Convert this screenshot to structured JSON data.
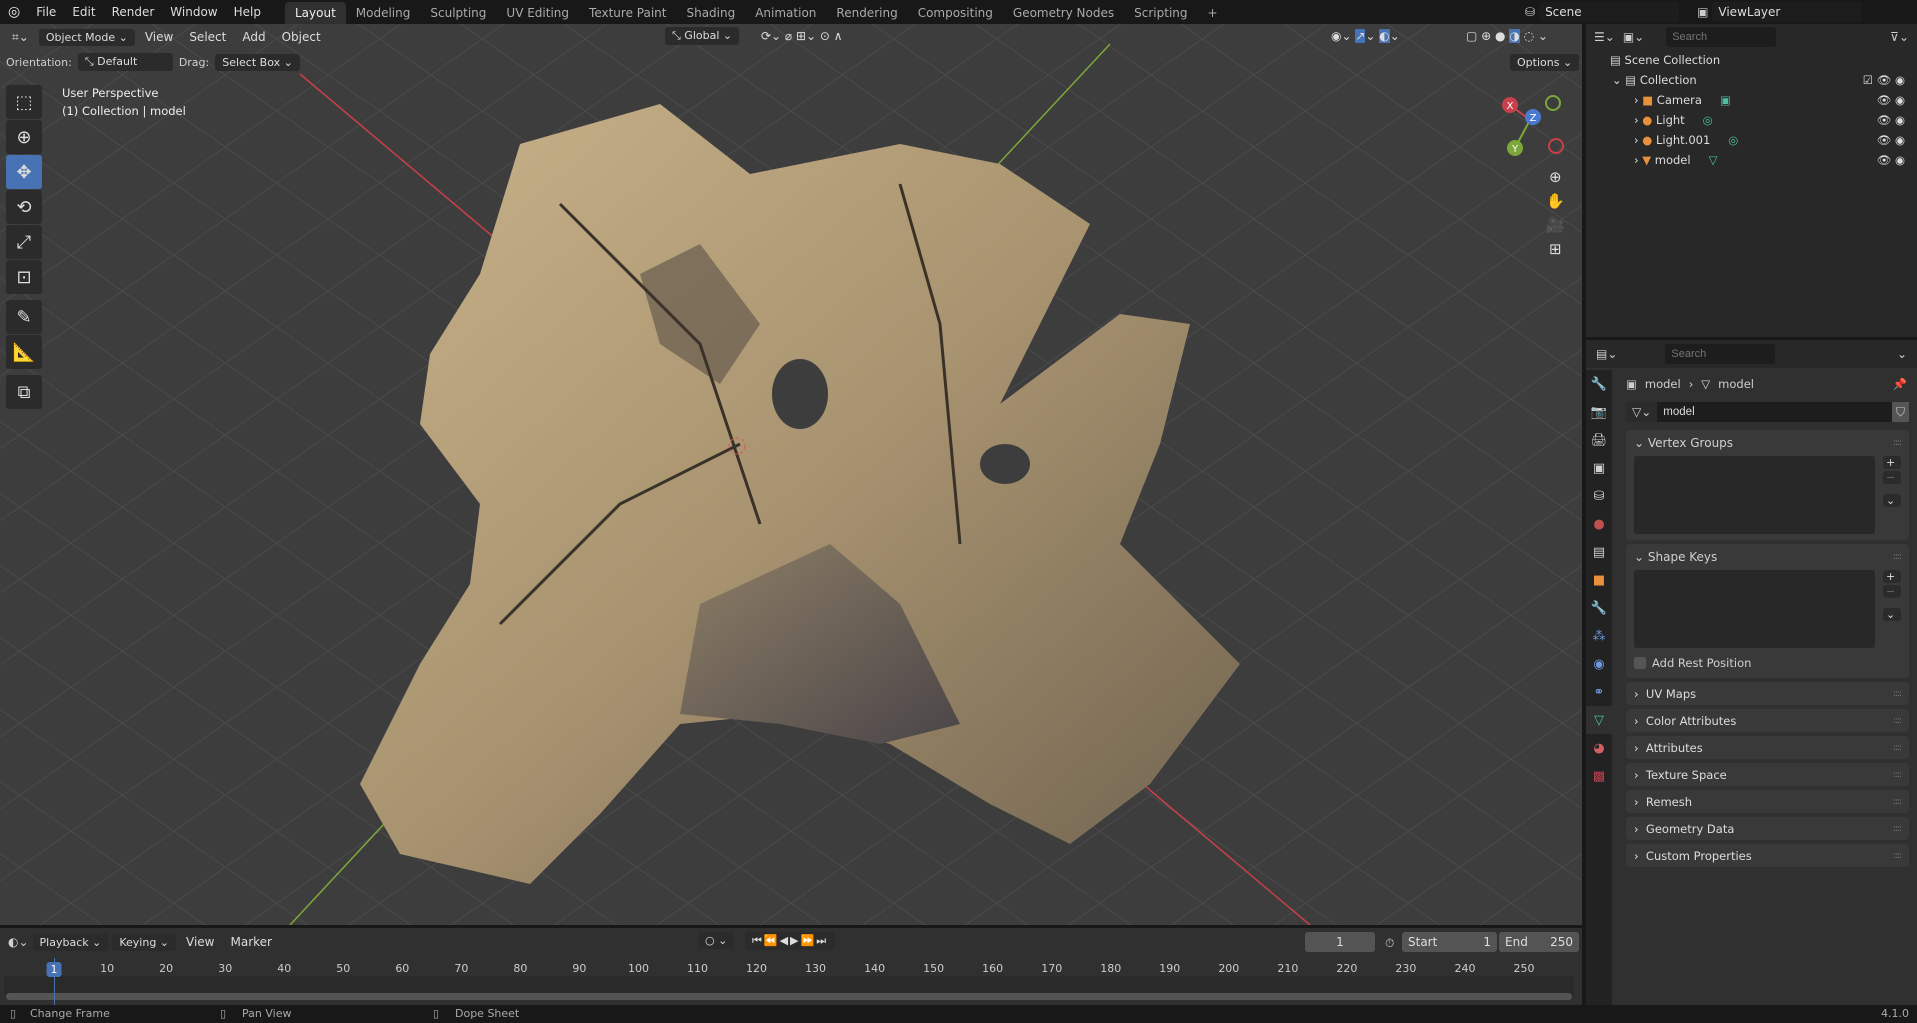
{
  "topbar": {
    "menus": [
      "File",
      "Edit",
      "Render",
      "Window",
      "Help"
    ],
    "workspaces": [
      "Layout",
      "Modeling",
      "Sculpting",
      "UV Editing",
      "Texture Paint",
      "Shading",
      "Animation",
      "Rendering",
      "Compositing",
      "Geometry Nodes",
      "Scripting"
    ],
    "add": "+",
    "scene": "Scene",
    "view_layer": "ViewLayer"
  },
  "viewport": {
    "mode": "Object Mode",
    "menus": [
      "View",
      "Select",
      "Add",
      "Object"
    ],
    "orientation_label": "Orientation:",
    "orientation": "Default",
    "drag_label": "Drag:",
    "drag": "Select Box",
    "transform": "Global",
    "options": "Options",
    "overlay_title": "User Perspective",
    "overlay_sub": "(1) Collection | model",
    "gizmo": {
      "x": "X",
      "y": "Y",
      "z": "Z"
    }
  },
  "outliner": {
    "search_placeholder": "Search",
    "root": "Scene Collection",
    "collection": "Collection",
    "items": [
      {
        "name": "Camera",
        "color": "#e8913a"
      },
      {
        "name": "Light",
        "color": "#e8913a"
      },
      {
        "name": "Light.001",
        "color": "#e8913a"
      },
      {
        "name": "model",
        "color": "#e8913a"
      }
    ]
  },
  "properties": {
    "search_placeholder": "Search",
    "breadcrumb": [
      "model",
      "model"
    ],
    "mesh_name": "model",
    "panels_open": [
      "Vertex Groups",
      "Shape Keys"
    ],
    "add_rest_position": "Add Rest Position",
    "panels": [
      "UV Maps",
      "Color Attributes",
      "Attributes",
      "Texture Space",
      "Remesh",
      "Geometry Data",
      "Custom Properties"
    ]
  },
  "timeline": {
    "menus": [
      "Playback",
      "Keying",
      "View",
      "Marker"
    ],
    "current_frame": "1",
    "start_label": "Start",
    "start": "1",
    "end_label": "End",
    "end": "250",
    "ticks": [
      "1",
      "10",
      "20",
      "30",
      "40",
      "50",
      "60",
      "70",
      "80",
      "90",
      "100",
      "110",
      "120",
      "130",
      "140",
      "150",
      "160",
      "170",
      "180",
      "190",
      "200",
      "210",
      "220",
      "230",
      "240",
      "250"
    ]
  },
  "status": {
    "change_frame": "Change Frame",
    "pan_view": "Pan View",
    "dope_sheet": "Dope Sheet",
    "version": "4.1.0"
  },
  "colors": {
    "accent": "#4772b3",
    "x_axis": "#c8404a",
    "y_axis": "#7ca83a"
  }
}
